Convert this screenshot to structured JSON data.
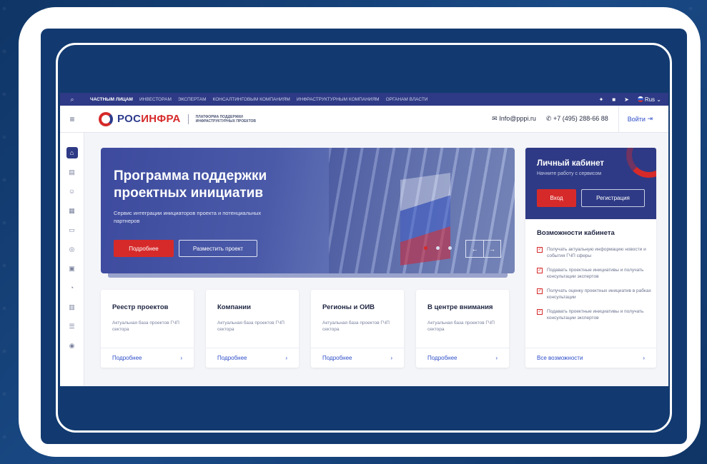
{
  "topbar": {
    "links": [
      "ЧАСТНЫМ ЛИЦАМ",
      "ИНВЕСТОРАМ",
      "ЭКСПЕРТАМ",
      "КОНСАЛТИНГОВЫМ КОМПАНИЯМ",
      "ИНФРАСТРУКТУРНЫМ КОМПАНИЯМ",
      "ОРГАНАМ ВЛАСТИ"
    ],
    "language": "Rus"
  },
  "header": {
    "logo_a": "РОС",
    "logo_b": "ИНФРА",
    "logo_sub": "ПЛАТФОРМА ПОДДЕРЖКИ ИНФРАСТРУКТУРНЫХ ПРОЕКТОВ",
    "email": "Info@pppi.ru",
    "phone": "+7 (495) 288-66 88",
    "login": "Войти"
  },
  "hero": {
    "title": "Программа поддержки проектных инициатив",
    "text": "Сервис интеграции инициаторов проекта и потенциальных партнеров",
    "btn_more": "Подробнее",
    "btn_place": "Разместить проект"
  },
  "cards": [
    {
      "title": "Реестр проектов",
      "text": "Актуальная база проектов ГЧП сектора",
      "more": "Подробнее"
    },
    {
      "title": "Компании",
      "text": "Актуальная база проектов ГЧП сектора",
      "more": "Подробнее"
    },
    {
      "title": "Регионы и ОИВ",
      "text": "Актуальная база проектов ГЧП сектора",
      "more": "Подробнее"
    },
    {
      "title": "В центре внимания",
      "text": "Актуальная база проектов ГЧП сектора",
      "more": "Подробнее"
    }
  ],
  "cabinet": {
    "title": "Личный кабинет",
    "subtitle": "Начните работу с сервисом",
    "btn_login": "Вход",
    "btn_register": "Регистрация",
    "features_title": "Возможности кабинета",
    "features": [
      "Получать актуальную информацию новости и события ГЧП сферы",
      "Подавать проектные инициативы и получать консультации экспертов",
      "Получать оценку проектных инициатив в рабках консультации",
      "Подавать проектные инициативы и получать консультации экспертов"
    ],
    "all": "Все возможности"
  },
  "colors": {
    "navy": "#2e3a85",
    "red": "#d62a2a",
    "link": "#2e4ec8",
    "frame_bg": "#123a6e"
  }
}
